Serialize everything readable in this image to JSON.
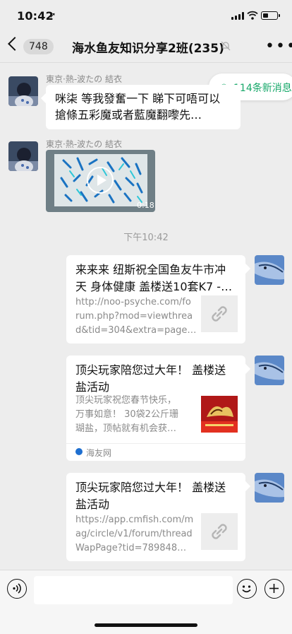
{
  "status_bar": {
    "time": "10:42"
  },
  "nav": {
    "back_count": "748",
    "title": "海水鱼友知识分享2班(235)"
  },
  "new_messages": {
    "label": "114条新消息"
  },
  "messages": [
    {
      "sender": "東京·熱-波たの 結衣",
      "text_line1": "咪柒 等我發奮一下 睇下可唔可以",
      "text_line2": "搶條五彩魔或者藍魔翻嚟先…"
    },
    {
      "sender": "東京·熱-波たの 結衣",
      "video_duration": "0:18"
    }
  ],
  "time_divider": "下午10:42",
  "cards": [
    {
      "title_line1": "来来来 纽斯祝全国鱼友牛市冲",
      "title_line2": "天 身体健康 盖楼送10套K7 -…",
      "desc_line1": "http://noo-psyche.com/fo",
      "desc_line2": "rum.php?mod=viewthrea",
      "desc_line3": "d&tid=304&extra=page…"
    },
    {
      "title_line1": "顶尖玩家陪您过大年！ 盖楼送",
      "title_line2": "盐活动",
      "desc_line1": "顶尖玩家祝您春节快乐，",
      "desc_line2": "万事如意！ 30袋2公斤珊",
      "desc_line3": "瑚盐，顶帖就有机会获…",
      "source": "海友网"
    },
    {
      "title_line1": "顶尖玩家陪您过大年！ 盖楼送",
      "title_line2": "盐活动",
      "desc_line1": "https://app.cmfish.com/m",
      "desc_line2": "ag/circle/v1/forum/thread",
      "desc_line3": "WapPage?tid=789848…"
    }
  ],
  "icons": {
    "back": "chevron-left-icon",
    "mute": "bell-slash-icon",
    "more": "ellipsis-icon",
    "voice": "voice-icon",
    "emoji": "emoji-icon",
    "plus": "plus-icon",
    "link": "link-icon"
  },
  "colors": {
    "background": "#ededed",
    "accent_green": "#17a86a",
    "bubble": "#ffffff"
  }
}
